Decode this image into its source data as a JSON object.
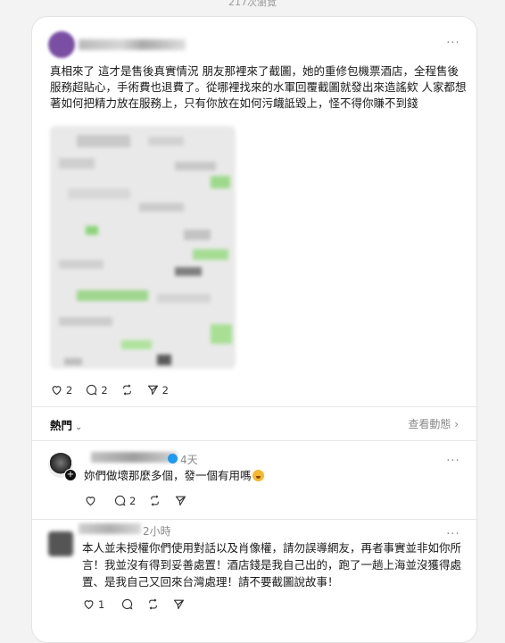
{
  "header": {
    "views_text": "217次瀏覽"
  },
  "post": {
    "text": "真相來了 這才是售後真實情況 朋友那裡來了截圖，她的重修包機票酒店，全程售後服務超貼心，手術費也退費了。從哪裡找來的水軍回覆截圖就發出來造謠欸 人家都想著如何把精力放在服務上，只有你放在如何污衊詆毀上，怪不得你賺不到錢",
    "likes": "2",
    "comments": "2",
    "shares": "2"
  },
  "tabs": {
    "hot": "熱門",
    "activity": "查看動態 ›"
  },
  "comments": [
    {
      "time": "4天",
      "text": "妳們做壞那麼多個，發一個有用嗎",
      "likes": "",
      "replies": "2"
    },
    {
      "time": "2小時",
      "text": "本人並未授權你們使用對話以及肖像權，請勿誤導網友，再者事實並非如你所言！我並沒有得到妥善處置！酒店錢是我自己出的，跑了一趟上海並沒獲得處置、是我自己又回來台灣處理！請不要截圖說故事！",
      "likes": "1",
      "replies": ""
    }
  ],
  "icons": {
    "heart": "heart-icon",
    "comment": "comment-icon",
    "repost": "repost-icon",
    "share": "share-icon",
    "more": "more-icon"
  },
  "colors": {
    "verified": "#1d9bf0",
    "muted": "#8a8a8a"
  }
}
